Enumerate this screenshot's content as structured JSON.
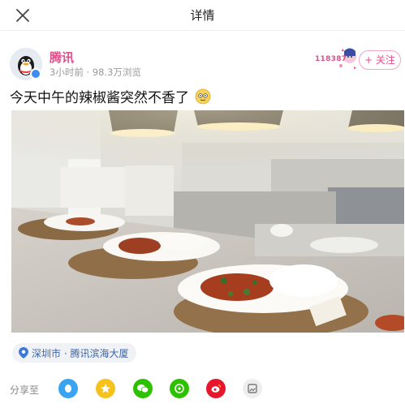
{
  "header": {
    "title": "详情",
    "close_icon": "close-icon"
  },
  "author": {
    "name": "腾讯",
    "time": "3小时前",
    "views": "98.3万浏览",
    "badge_number": "118387",
    "follow_label": "+ 关注"
  },
  "post": {
    "text": "今天中午的辣椒酱突然不香了",
    "emoji": "sweat-smile-emoji"
  },
  "location": {
    "label": "深圳市 · 腾讯滨海大厦",
    "icon": "location-pin-icon"
  },
  "share": {
    "label": "分享至",
    "targets": [
      "qq",
      "qzone",
      "wechat",
      "moments",
      "weibo",
      "image"
    ]
  },
  "colors": {
    "accent_pink": "#e0508a",
    "location_text": "#3b66a8",
    "qq_blue": "#3aa4f2",
    "qzone_yellow": "#f5c21b",
    "wechat_green": "#2dc100",
    "weibo_red": "#e6162d"
  }
}
